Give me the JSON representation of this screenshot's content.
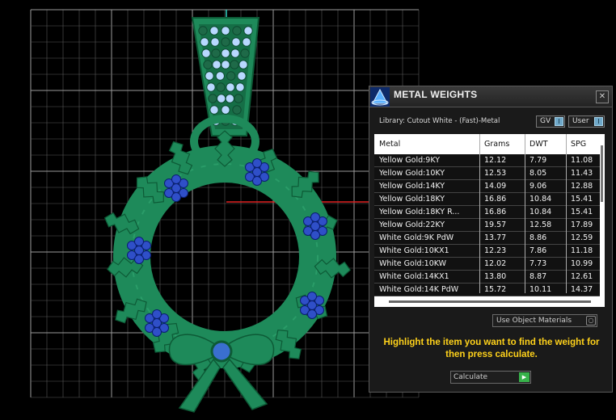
{
  "viewport": {
    "metal_color": "#1e8a5a",
    "grid_color": "#cfcfcf",
    "axis_color_green": "#2fd0c0",
    "axis_color_red": "#e02020",
    "gem_color": "#2f4fc8",
    "pave_color": "#b8d8ff"
  },
  "panel": {
    "title": "METAL WEIGHTS",
    "close_icon": "close-icon",
    "library_label": "Library: Cutout White - (Fast)-Metal",
    "gv_label": "GV",
    "user_label": "User",
    "toggle_glyph": "I",
    "close_glyph": "✕",
    "table": {
      "headers": [
        "Metal",
        "Grams",
        "DWT",
        "SPG"
      ],
      "rows": [
        [
          "Yellow Gold:9KY",
          "12.12",
          "7.79",
          "11.08"
        ],
        [
          "Yellow Gold:10KY",
          "12.53",
          "8.05",
          "11.43"
        ],
        [
          "Yellow Gold:14KY",
          "14.09",
          "9.06",
          "12.88"
        ],
        [
          "Yellow Gold:18KY",
          "16.86",
          "10.84",
          "15.41"
        ],
        [
          "Yellow Gold:18KY R...",
          "16.86",
          "10.84",
          "15.41"
        ],
        [
          "Yellow Gold:22KY",
          "19.57",
          "12.58",
          "17.89"
        ],
        [
          "White Gold:9K PdW",
          "13.77",
          "8.86",
          "12.59"
        ],
        [
          "White Gold:10KX1",
          "12.23",
          "7.86",
          "11.18"
        ],
        [
          "White Gold:10KW",
          "12.02",
          "7.73",
          "10.99"
        ],
        [
          "White Gold:14KX1",
          "13.80",
          "8.87",
          "12.61"
        ],
        [
          "White Gold:14K PdW",
          "15.72",
          "10.11",
          "14.37"
        ]
      ]
    },
    "materials_label": "Use Object Materials",
    "materials_glyph": "○",
    "instruction": "Highlight the item you want to find the weight for then press calculate.",
    "calculate_label": "Calculate",
    "calculate_glyph": "▶"
  }
}
